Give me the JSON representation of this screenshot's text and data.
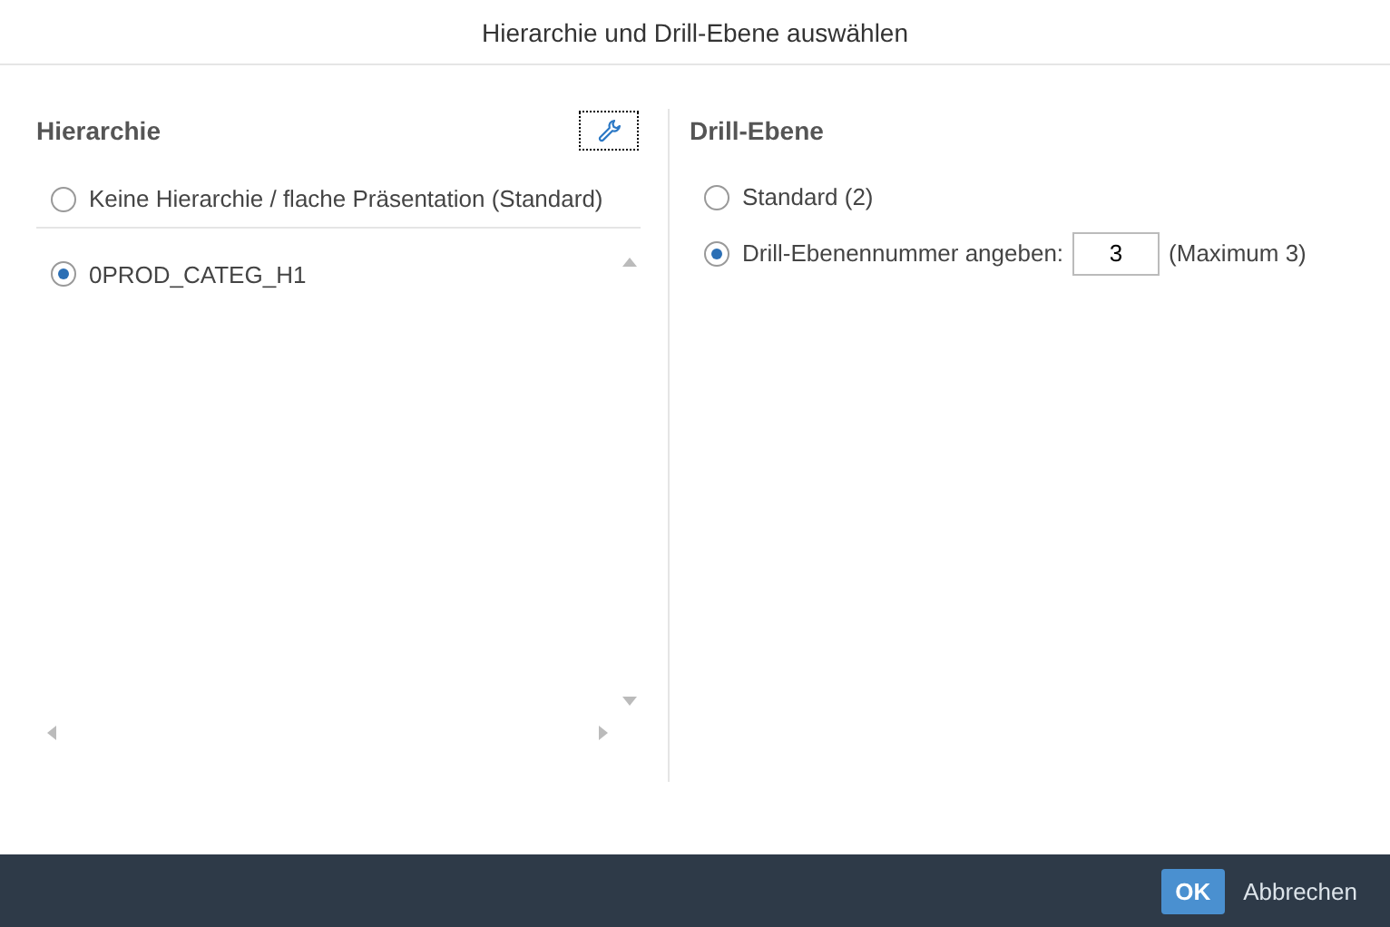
{
  "dialog": {
    "title": "Hierarchie und Drill-Ebene auswählen"
  },
  "hierarchy": {
    "heading": "Hierarchie",
    "options": [
      {
        "label": "Keine Hierarchie / flache Präsentation (Standard)",
        "selected": false
      },
      {
        "label": "0PROD_CATEG_H1",
        "selected": true
      }
    ]
  },
  "drill": {
    "heading": "Drill-Ebene",
    "options": [
      {
        "kind": "plain",
        "label": "Standard (2)",
        "selected": false
      },
      {
        "kind": "number",
        "label": "Drill-Ebenennummer angeben:",
        "value": "3",
        "hint": "(Maximum 3)",
        "selected": true
      }
    ]
  },
  "buttons": [
    {
      "label": "OK",
      "primary": true
    },
    {
      "label": "Abbrechen",
      "primary": false
    }
  ]
}
